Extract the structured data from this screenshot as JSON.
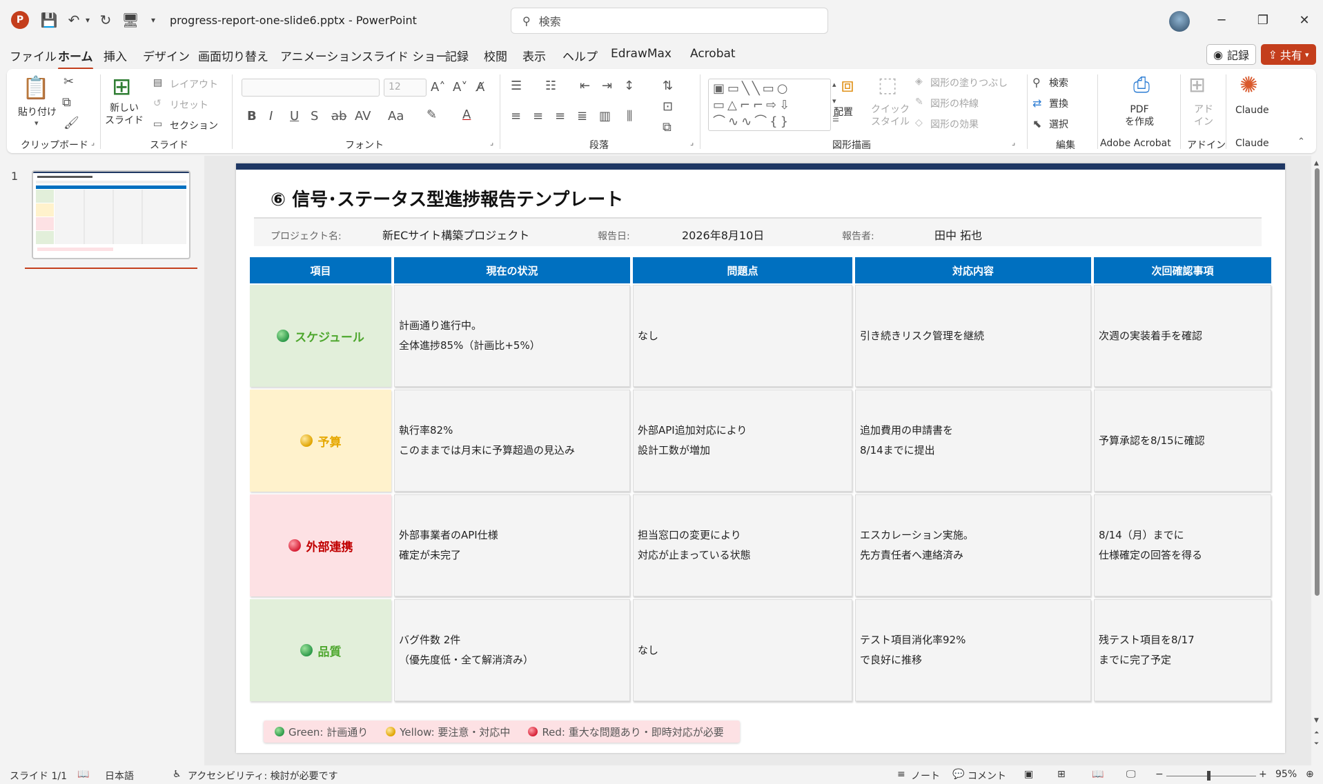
{
  "app": {
    "doc_title": "progress-report-one-slide6.pptx  -  PowerPoint",
    "search_placeholder": "検索",
    "record_label": "記録",
    "share_label": "共有"
  },
  "menu_tabs": [
    "ファイル",
    "ホーム",
    "挿入",
    "デザイン",
    "画面切り替え",
    "アニメーション",
    "スライド ショー",
    "記録",
    "校閲",
    "表示",
    "ヘルプ",
    "EdrawMax",
    "Acrobat"
  ],
  "ribbon": {
    "groups": [
      "クリップボード",
      "スライド",
      "フォント",
      "段落",
      "図形描画",
      "編集",
      "Adobe Acrobat",
      "アドイン",
      "Claude"
    ],
    "paste_label": "貼り付け",
    "new_slide_label": "新しい\nスライド",
    "layout_label": "レイアウト",
    "reset_label": "リセット",
    "section_label": "セクション",
    "font_size": "12",
    "arrange_label": "配置",
    "quick_style_label": "クイック\nスタイル",
    "shape_fill_label": "図形の塗りつぶし",
    "shape_outline_label": "図形の枠線",
    "shape_effect_label": "図形の効果",
    "find_label": "検索",
    "replace_label": "置換",
    "select_label": "選択",
    "pdf_label": "PDF\nを作成",
    "addin_label": "アド\nイン",
    "claude_label": "Claude"
  },
  "thumbnail": {
    "slide_number": "1"
  },
  "slide": {
    "title": "⑥ 信号･ステータス型進捗報告テンプレート",
    "project_label": "プロジェクト名:",
    "project_value": "新ECサイト構築プロジェクト",
    "date_label": "報告日:",
    "date_value": "2026年8月10日",
    "reporter_label": "報告者:",
    "reporter_value": "田中 拓也",
    "headers": [
      "項目",
      "現在の状況",
      "問題点",
      "対応内容",
      "次回確認事項"
    ],
    "rows": [
      {
        "category": "スケジュール",
        "status": "green",
        "cells": [
          [
            "計画通り進行中。",
            "全体進捗85%（計画比+5%）"
          ],
          [
            "なし"
          ],
          [
            "引き続きリスク管理を継続"
          ],
          [
            "次週の実装着手を確認"
          ]
        ]
      },
      {
        "category": "予算",
        "status": "yellow",
        "cells": [
          [
            "執行率82%",
            "このままでは月末に予算超過の見込み"
          ],
          [
            "外部API追加対応により",
            "設計工数が増加"
          ],
          [
            "追加費用の申請書を",
            "8/14までに提出"
          ],
          [
            "予算承認を8/15に確認"
          ]
        ]
      },
      {
        "category": "外部連携",
        "status": "red",
        "cells": [
          [
            "外部事業者のAPI仕様",
            "確定が未完了"
          ],
          [
            "担当窓口の変更により",
            "対応が止まっている状態"
          ],
          [
            "エスカレーション実施。",
            "先方責任者へ連絡済み"
          ],
          [
            "8/14（月）までに",
            "仕様確定の回答を得る"
          ]
        ]
      },
      {
        "category": "品質",
        "status": "green",
        "cells": [
          [
            "バグ件数 2件",
            "（優先度低・全て解消済み）"
          ],
          [
            "なし"
          ],
          [
            "テスト項目消化率92%",
            "で良好に推移"
          ],
          [
            "残テスト項目を8/17",
            "までに完了予定"
          ]
        ]
      }
    ],
    "legend": [
      "Green: 計画通り",
      "Yellow: 要注意・対応中",
      "Red: 重大な問題あり・即時対応が必要"
    ]
  },
  "colors": {
    "accent": "#c43e1c",
    "header_blue": "#0070c0",
    "green_bg": "#e2efda",
    "green_text": "#4ea72e",
    "yellow_bg": "#fff2cc",
    "yellow_text": "#e6a800",
    "red_bg": "#fde1e4",
    "red_text": "#c00000"
  },
  "status": {
    "slide_indicator": "スライド 1/1",
    "language": "日本語",
    "accessibility": "アクセシビリティ: 検討が必要です",
    "notes_label": "ノート",
    "comments_label": "コメント",
    "zoom_minus": "−",
    "zoom_plus": "+",
    "zoom": "95%"
  }
}
